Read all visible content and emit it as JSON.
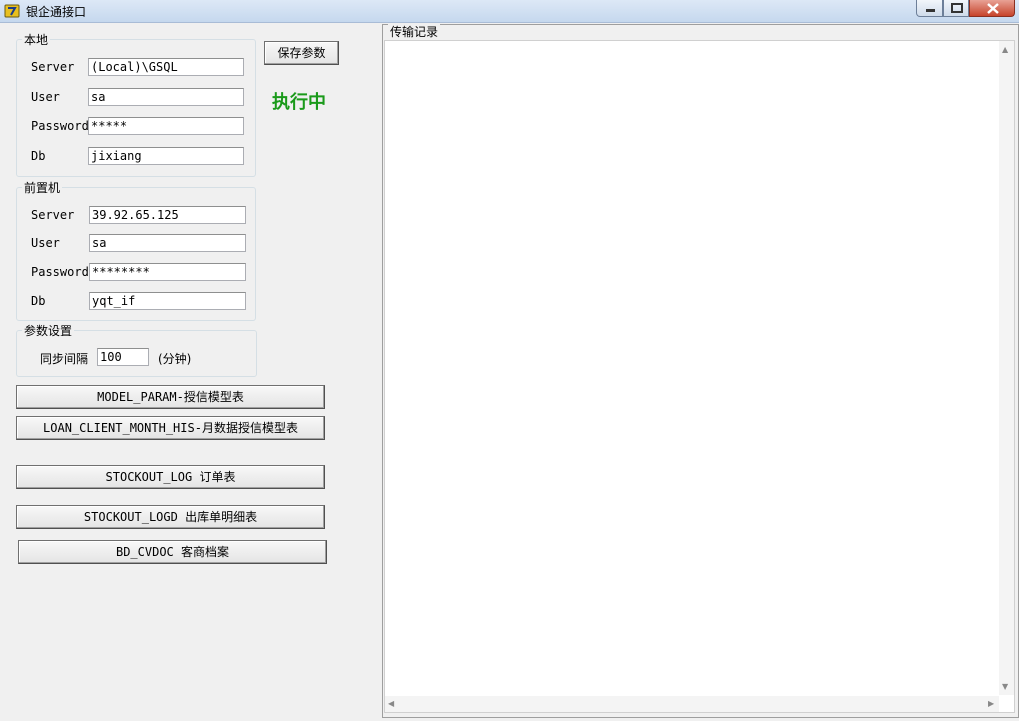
{
  "window": {
    "title": "银企通接口"
  },
  "local": {
    "legend": "本地",
    "server_label": "Server",
    "server_value": "(Local)\\GSQL",
    "user_label": "User",
    "user_value": "sa",
    "password_label": "Password",
    "password_value": "*****",
    "db_label": "Db",
    "db_value": "jixiang"
  },
  "frontend": {
    "legend": "前置机",
    "server_label": "Server",
    "server_value": "39.92.65.125",
    "user_label": "User",
    "user_value": "sa",
    "password_label": "Password",
    "password_value": "********",
    "db_label": "Db",
    "db_value": "yqt_if"
  },
  "params": {
    "legend": "参数设置",
    "interval_label": "同步间隔",
    "interval_value": "100",
    "interval_unit": "(分钟)"
  },
  "save_button": "保存参数",
  "status_text": "执行中",
  "status_color": "#1a9a1a",
  "actions": [
    "MODEL_PARAM-授信模型表",
    "LOAN_CLIENT_MONTH_HIS-月数据授信模型表",
    "STOCKOUT_LOG 订单表",
    "STOCKOUT_LOGD 出库单明细表",
    "BD_CVDOC 客商档案"
  ],
  "log": {
    "title": "传输记录",
    "content": ""
  }
}
